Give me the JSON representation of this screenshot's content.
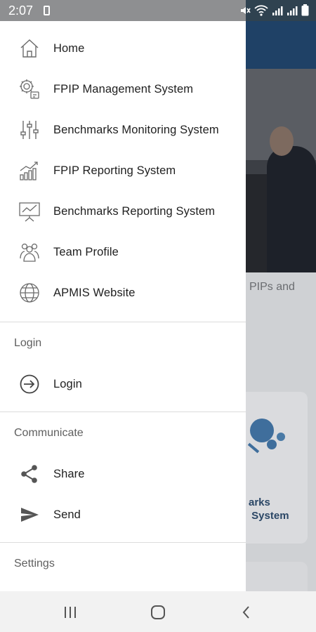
{
  "status_bar": {
    "time": "2:07",
    "icons": [
      "battery-saver-icon",
      "mute-icon",
      "wifi-icon",
      "signal-icon",
      "signal-icon",
      "battery-icon"
    ]
  },
  "drawer": {
    "main_items": [
      {
        "label": "Home",
        "icon": "home-icon"
      },
      {
        "label": "FPIP Management System",
        "icon": "settings-gears-icon"
      },
      {
        "label": "Benchmarks Monitoring System",
        "icon": "sliders-icon"
      },
      {
        "label": "FPIP Reporting System",
        "icon": "growth-chart-icon"
      },
      {
        "label": "Benchmarks Reporting System",
        "icon": "presentation-board-icon"
      },
      {
        "label": "Team Profile",
        "icon": "team-icon"
      },
      {
        "label": "APMIS Website",
        "icon": "globe-icon"
      }
    ],
    "sections": [
      {
        "header": "Login",
        "items": [
          {
            "label": "Login",
            "icon": "login-icon"
          }
        ]
      },
      {
        "header": "Communicate",
        "items": [
          {
            "label": "Share",
            "icon": "share-icon"
          },
          {
            "label": "Send",
            "icon": "send-icon"
          }
        ]
      },
      {
        "header": "Settings",
        "items": []
      }
    ]
  },
  "background": {
    "hero_text": "PIPs and",
    "card_text": "arks\n System"
  },
  "nav_bar": {
    "buttons": [
      "recent-apps-icon",
      "home-button-icon",
      "back-icon"
    ]
  },
  "colors": {
    "status_bar": "#8e8f91",
    "app_bar": "#1f4166",
    "drawer_bg": "#ffffff",
    "text": "#1f1f1f",
    "section_header": "#5f5f5f",
    "nav_bar": "#f2f2f2"
  }
}
